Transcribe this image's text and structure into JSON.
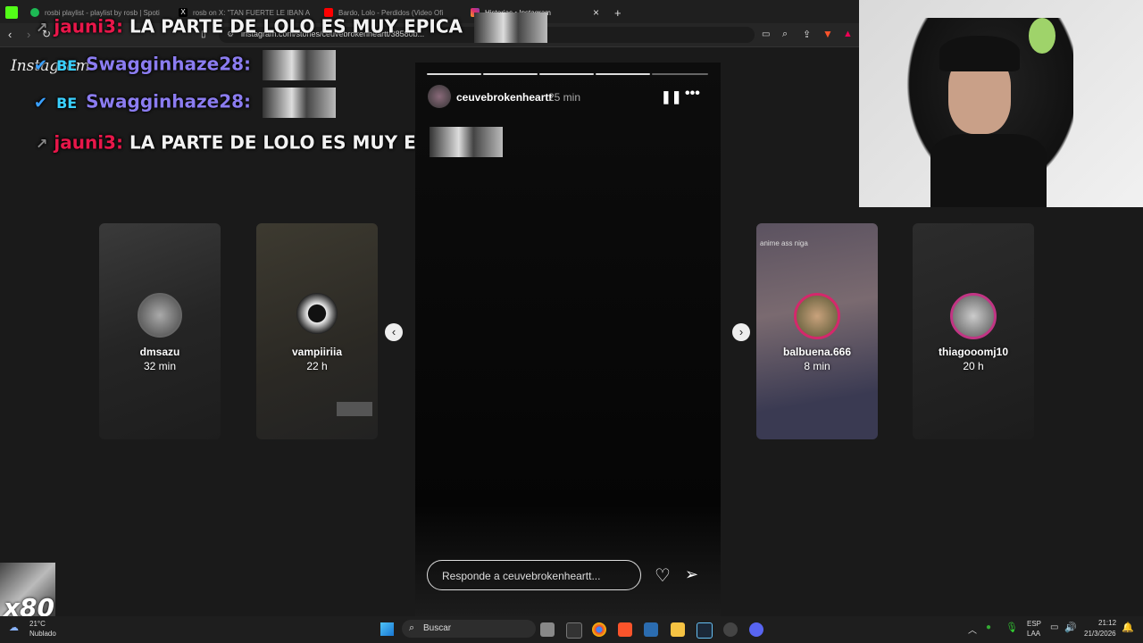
{
  "browser": {
    "tabs": [
      {
        "label": "rosbi playlist - playlist by rosb | Spoti"
      },
      {
        "label": "rosb on X: \"TAN FUERTE LE IBAN A A"
      },
      {
        "label": "Bardo, Lolo - Perdidos (Video Ofi"
      },
      {
        "label": "Historias • Instagram"
      }
    ],
    "url": "instagram.com/stories/ceuvebrokenheartt/38580b...",
    "new_tab": "+",
    "close_tab": "×",
    "app_logo": "Instagram"
  },
  "chat": [
    {
      "user": "jauni3:",
      "message": "LA PARTE DE LOLO ES MUY EPICA"
    },
    {
      "user": "Swagginhaze28:",
      "message": ""
    },
    {
      "user": "Swagginhaze28:",
      "message": ""
    },
    {
      "user": "jauni3:",
      "message": "LA PARTE DE LOLO ES MUY EPICA"
    }
  ],
  "story": {
    "username": "ceuvebrokenheartt",
    "time": "25 min",
    "progress_segments": 5,
    "reply_placeholder": "Responde a ceuvebrokenheartt..."
  },
  "side_stories": [
    {
      "username": "dmsazu",
      "time": "32 min"
    },
    {
      "username": "vampiiriia",
      "time": "22 h"
    },
    {
      "username": "balbuena.666",
      "time": "8 min",
      "caption": "anime ass niga"
    },
    {
      "username": "thiagooomj10",
      "time": "20 h"
    }
  ],
  "overlay_badge": "x80",
  "taskbar": {
    "weather_temp": "21°C",
    "weather_desc": "Nublado",
    "search_label": "Buscar",
    "lang_top": "ESP",
    "lang_bottom": "LAA",
    "time": "21:12",
    "date": "21/3/2026"
  }
}
